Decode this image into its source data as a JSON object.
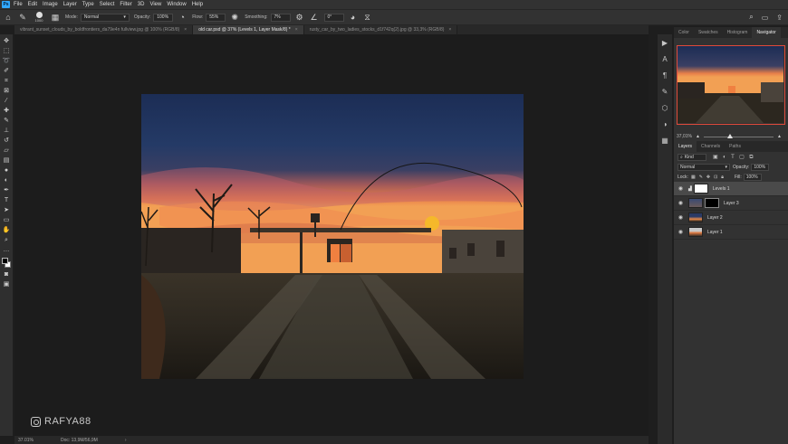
{
  "menu": {
    "app_logo": "Ps",
    "items": [
      "File",
      "Edit",
      "Image",
      "Layer",
      "Type",
      "Select",
      "Filter",
      "3D",
      "View",
      "Window",
      "Help"
    ]
  },
  "options": {
    "brush_size": "1000",
    "mode_label": "Mode:",
    "mode_value": "Normal",
    "opacity_label": "Opacity:",
    "opacity_value": "100%",
    "flow_label": "Flow:",
    "flow_value": "55%",
    "smoothing_label": "Smoothing:",
    "smoothing_value": "7%",
    "angle_value": "0°"
  },
  "tabs": [
    {
      "label": "vibrant_sunset_clouds_by_boldfrontiers_da79e4n fullview.jpg @ 100% (RGB/8)",
      "active": false
    },
    {
      "label": "old car.psd @ 37% (Levels 1, Layer Mask/8) *",
      "active": true
    },
    {
      "label": "rusty_car_by_two_ladies_stocks_d1f742q(2).jpg @ 33,3% (RGB/8)",
      "active": false
    }
  ],
  "watermark": "RAFYA88",
  "status": {
    "zoom": "37.01%",
    "doc": "Doc: 13,9M/56,9M"
  },
  "navigator": {
    "tabs": [
      "Color",
      "Swatches",
      "Histogram",
      "Navigator"
    ],
    "active_tab": "Navigator",
    "zoom": "37,01%"
  },
  "layers": {
    "tabs": [
      "Layers",
      "Channels",
      "Paths"
    ],
    "kind_value": "Kind",
    "blend_value": "Normal",
    "opacity_label": "Opacity:",
    "opacity_value": "100%",
    "lock_label": "Lock:",
    "fill_label": "Fill:",
    "fill_value": "100%",
    "items": [
      {
        "name": "Levels 1",
        "selected": true
      },
      {
        "name": "Layer 3",
        "selected": false
      },
      {
        "name": "Layer 2",
        "selected": false
      },
      {
        "name": "Layer 1",
        "selected": false
      }
    ]
  },
  "colors": {
    "accent": "#31a8ff",
    "nav_frame": "#e04a3a",
    "sun": "#f5b82a"
  }
}
